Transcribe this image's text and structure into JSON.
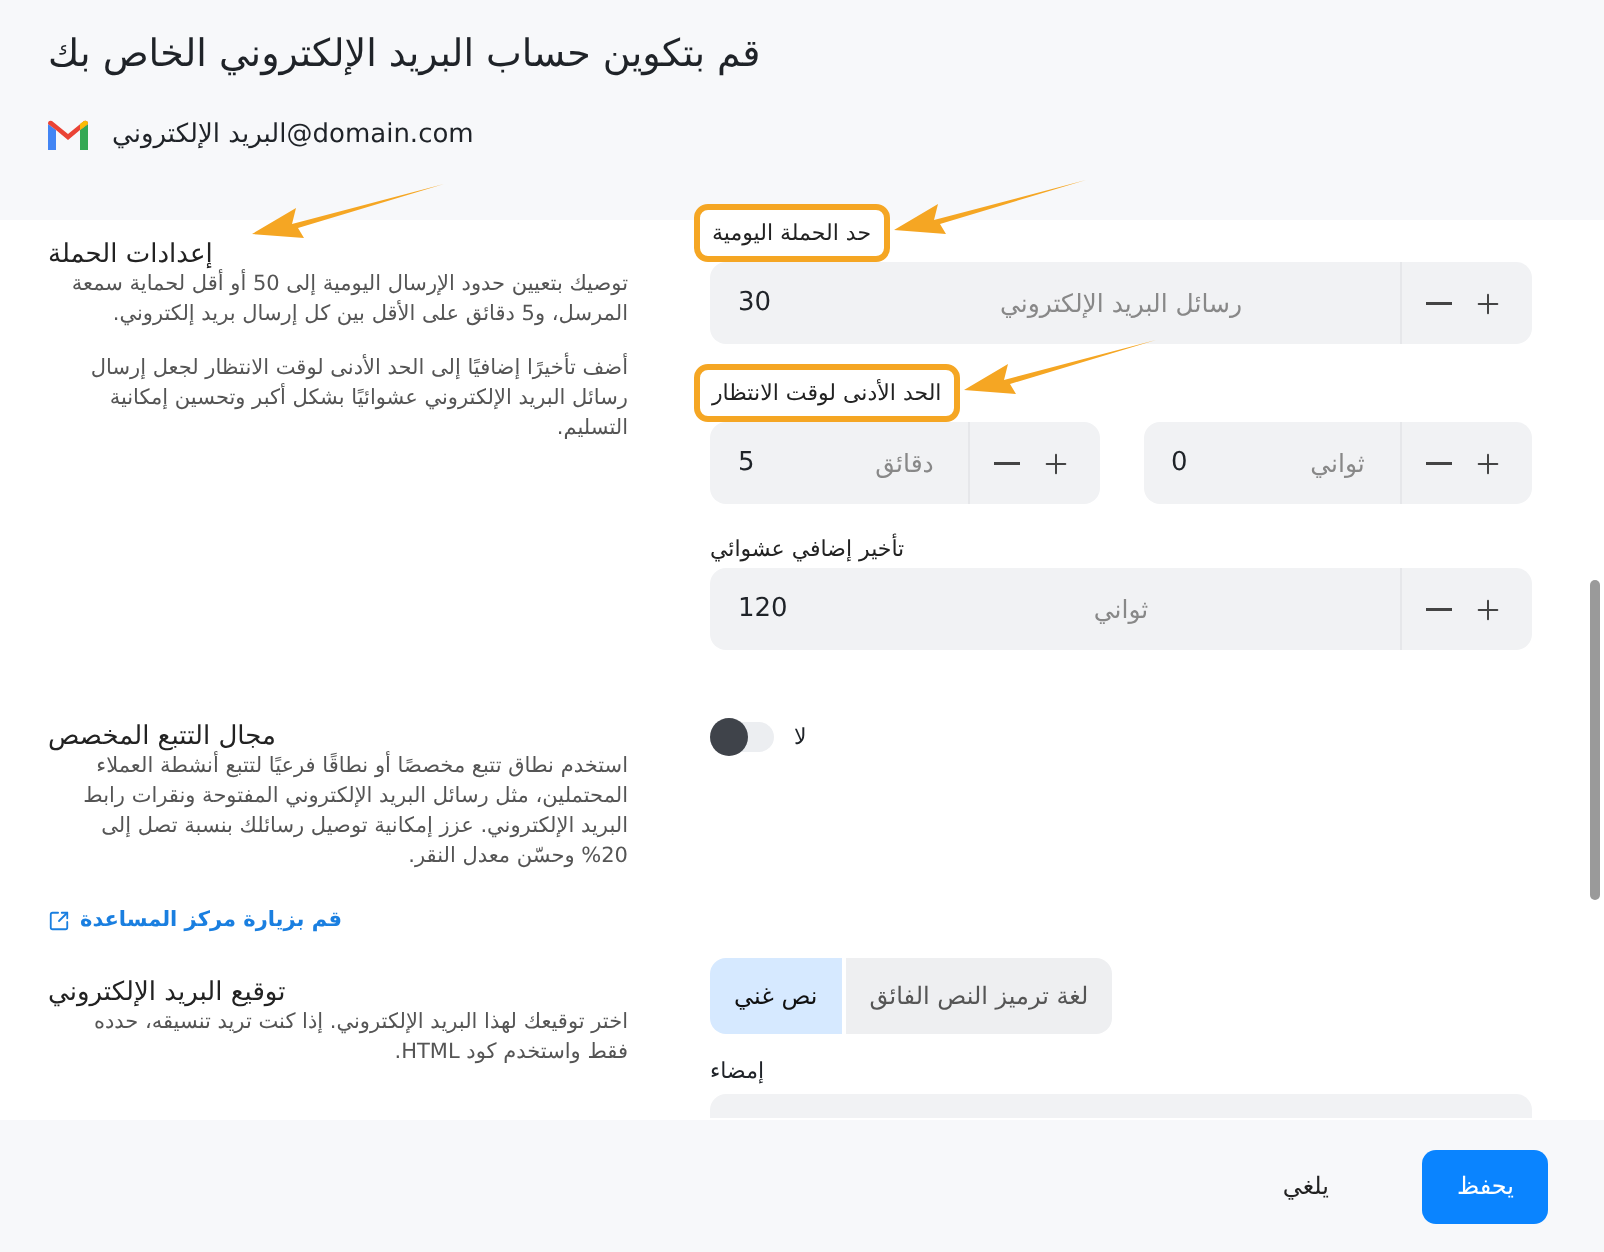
{
  "title": "قم بتكوين حساب البريد الإلكتروني الخاص بك",
  "account": {
    "email": "البريد الإلكتروني@domain.com"
  },
  "sections": [
    {
      "title": "إعدادات الحملة",
      "arrow": true,
      "paragraphs": [
        "توصيك بتعيين حدود الإرسال اليومية إلى 50 أو أقل لحماية سمعة المرسل، و5 دقائق على الأقل بين كل إرسال بريد إلكتروني.",
        "أضف تأخيرًا إضافيًا إلى الحد الأدنى لوقت الانتظار لجعل إرسال رسائل البريد الإلكتروني عشوائيًا بشكل أكبر وتحسين إمكانية التسليم."
      ],
      "controls": [
        {
          "kind": "steppers",
          "label": "حد الحملة اليومية",
          "highlighted": true,
          "steppers": [
            {
              "value": "30",
              "unit": "رسائل البريد الإلكتروني"
            }
          ]
        },
        {
          "kind": "steppers",
          "label": "الحد الأدنى لوقت الانتظار",
          "highlighted": true,
          "steppers": [
            {
              "value": "0",
              "unit": "ثواني"
            },
            {
              "value": "5",
              "unit": "دقائق"
            }
          ]
        },
        {
          "kind": "steppers",
          "label": "تأخير إضافي عشوائي",
          "highlighted": false,
          "steppers": [
            {
              "value": "120",
              "unit": "ثواني"
            }
          ]
        }
      ]
    },
    {
      "title": "مجال التتبع المخصص",
      "paragraphs": [
        "استخدم نطاق تتبع مخصصًا أو نطاقًا فرعيًا لتتبع أنشطة العملاء المحتملين، مثل رسائل البريد الإلكتروني المفتوحة ونقرات رابط البريد الإلكتروني. عزز إمكانية توصيل رسائلك بنسبة تصل إلى 20% وحسّن معدل النقر."
      ],
      "link": "قم بزيارة مركز المساعدة",
      "controls": [
        {
          "kind": "toggle",
          "on": false,
          "label": "لا"
        }
      ]
    },
    {
      "title": "توقيع البريد الإلكتروني",
      "paragraphs": [
        "اختر توقيعك لهذا البريد الإلكتروني. إذا كنت تريد تنسيقه، حدده فقط واستخدم كود HTML."
      ],
      "controls": [
        {
          "kind": "segmented",
          "options": [
            {
              "label": "لغة ترميز النص الفائق",
              "selected": false
            },
            {
              "label": "نص غني",
              "selected": true
            }
          ]
        },
        {
          "kind": "field",
          "label": "إمضاء"
        }
      ]
    }
  ],
  "buttons": [
    {
      "label": "يحفظ",
      "kind": "primary"
    },
    {
      "label": "يلغي",
      "kind": "secondary"
    }
  ]
}
